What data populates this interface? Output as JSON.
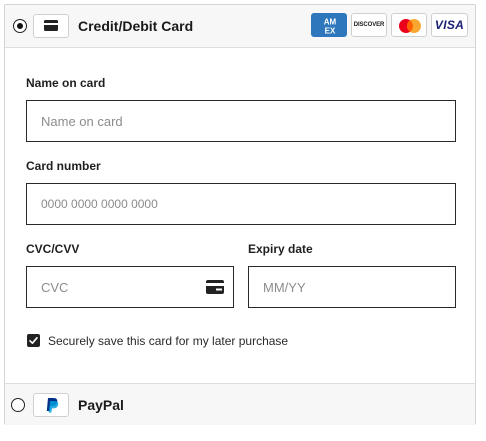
{
  "payment": {
    "card_option_label": "Credit/Debit Card",
    "paypal_option_label": "PayPal",
    "brands": {
      "amex": "AM EX",
      "discover": "DISCOVER",
      "visa": "VISA"
    },
    "name_label": "Name on card",
    "name_placeholder": "Name on card",
    "number_label": "Card number",
    "number_placeholder": "0000 0000 0000 0000",
    "cvc_label": "CVC/CVV",
    "cvc_placeholder": "CVC",
    "expiry_label": "Expiry date",
    "expiry_placeholder": "MM/YY",
    "save_card_label": "Securely save this card for my later purchase",
    "save_card_checked": true
  },
  "colors": {
    "amex": "#2e77bc",
    "mastercard_red": "#eb001b",
    "mastercard_orange": "#f79e1b",
    "visa": "#1a1f71",
    "paypal_dark": "#003087",
    "paypal_light": "#009cde"
  },
  "icons": {
    "card_method": "credit-card-icon",
    "cvc": "card-back-icon",
    "paypal": "paypal-logo",
    "checkbox": "check-icon"
  }
}
